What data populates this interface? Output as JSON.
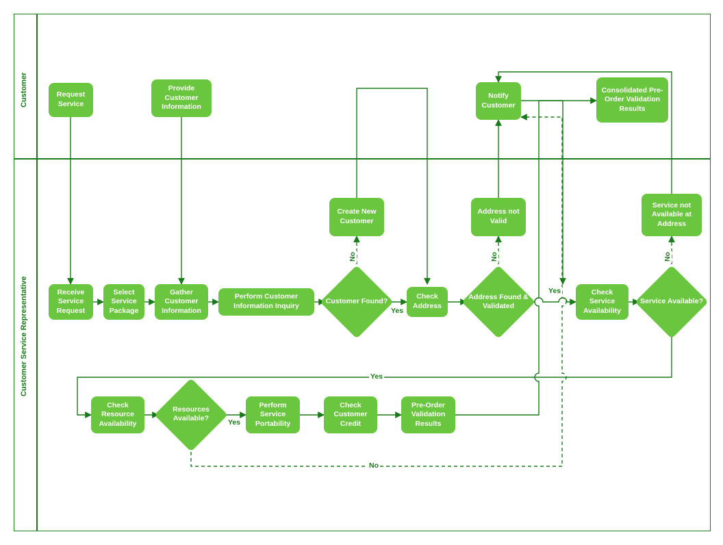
{
  "lanes": {
    "customer": "Customer",
    "csr": "Customer Service Representative"
  },
  "nodes": {
    "request_service": "Request Service",
    "provide_customer_info": "Provide Customer Information",
    "notify_customer": "Notify Customer",
    "consolidated_results": "Consolidated Pre-Order Validation Results",
    "receive_service_request": "Receive Service Request",
    "select_service_package": "Select Service Package",
    "gather_customer_info": "Gather Customer Information",
    "perform_customer_inquiry": "Perform Customer Information Inquiry",
    "customer_found": "Customer Found?",
    "create_new_customer": "Create New Customer",
    "check_address": "Check Address",
    "address_found_validated": "Address Found & Validated",
    "address_not_valid": "Address not Valid",
    "check_service_availability": "Check Service Availability",
    "service_available": "Service Available?",
    "service_not_available": "Service not Available at Address",
    "check_resource_availability": "Check Resource Availability",
    "resources_available": "Resources Available?",
    "perform_service_portability": "Perform Service Portability",
    "check_customer_credit": "Check Customer Credit",
    "preorder_validation_results": "Pre-Order Validation Results"
  },
  "labels": {
    "yes": "Yes",
    "no": "No"
  },
  "colors": {
    "node": "#6ac63e",
    "border": "#1a7a1a",
    "text_dark": "#1a7a1a"
  }
}
